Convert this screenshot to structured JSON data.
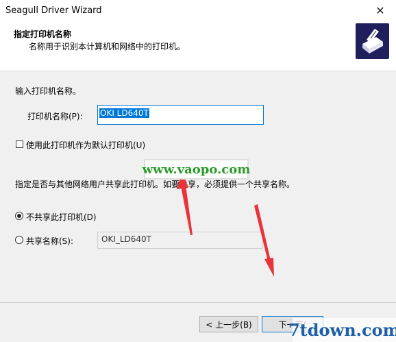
{
  "window": {
    "title": "Seagull Driver Wizard",
    "close_glyph": "✕"
  },
  "header": {
    "title": "指定打印机名称",
    "subtitle": "名称用于识别本计算机和网络中的打印机。",
    "icon": "printer-icon"
  },
  "form": {
    "intro": "输入打印机名称。",
    "printer_name_label": "打印机名称(P):",
    "printer_name_value": "OKI LD640T",
    "default_checkbox_label": "使用此打印机作为默认打印机(U)",
    "default_checked": false,
    "share_prompt": "指定是否与其他网络用户共享此打印机。如要共享，必须提供一个共享名称。",
    "no_share_label": "不共享此打印机(D)",
    "share_label": "共享名称(S):",
    "share_selected": "no_share",
    "share_name_value": "OKI_LD640T"
  },
  "footer": {
    "back_label": "< 上一步(B)",
    "next_label": "下一页("
  },
  "overlays": {
    "watermark_text": "www.vaopo.com",
    "watermark2_text": "7tdown.com",
    "arrow_color": "#e8333a"
  }
}
